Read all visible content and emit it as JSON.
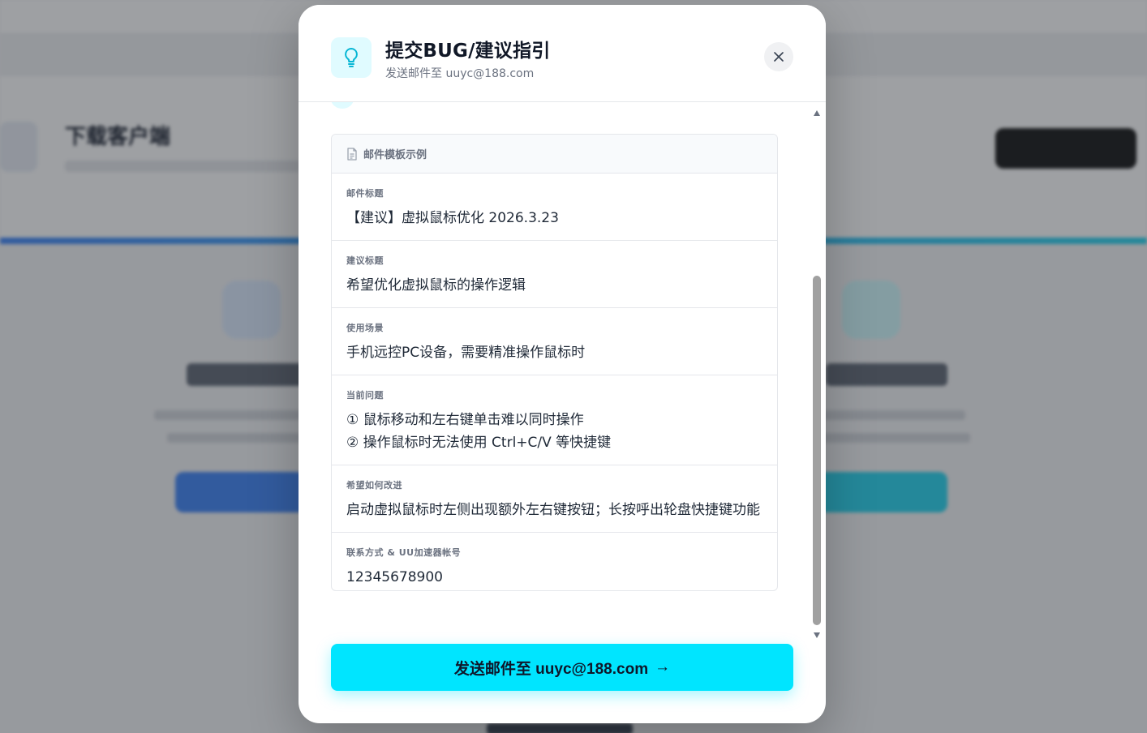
{
  "modal": {
    "title": "提交BUG/建议指引",
    "subtitle": "发送邮件至 uuyc@188.com",
    "close_label": "×"
  },
  "background": {
    "download_heading": "下载客户端"
  },
  "template": {
    "header_label": "邮件模板示例",
    "fields": [
      {
        "label": "邮件标题",
        "value": "【建议】虚拟鼠标优化 2026.3.23"
      },
      {
        "label": "建议标题",
        "value": "希望优化虚拟鼠标的操作逻辑"
      },
      {
        "label": "使用场景",
        "value": "手机远控PC设备，需要精准操作鼠标时"
      },
      {
        "label": "当前问题",
        "lines": [
          "① 鼠标移动和左右键单击难以同时操作",
          "② 操作鼠标时无法使用 Ctrl+C/V 等快捷键"
        ]
      },
      {
        "label": "希望如何改进",
        "value": "启动虚拟鼠标时左侧出现额外左右键按钮；长按呼出轮盘快捷键功能"
      },
      {
        "label": "联系方式 & UU加速器帐号",
        "value": "12345678900"
      }
    ]
  },
  "send_button": {
    "label": "发送邮件至 uuyc@188.com",
    "arrow": "→"
  },
  "colors": {
    "accent": "#00e5ff",
    "icon_bg": "#e0fbff"
  }
}
